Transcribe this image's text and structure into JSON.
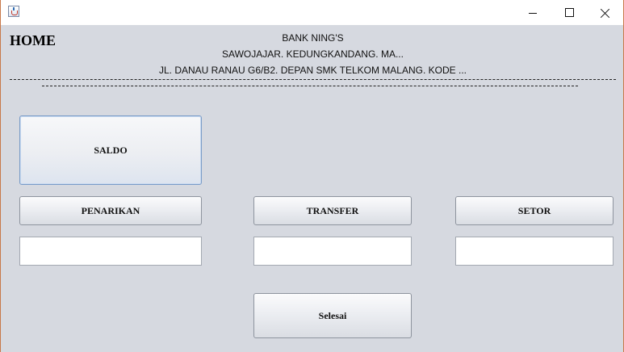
{
  "window": {
    "icon": "java-cup-icon",
    "controls": [
      "minimize-icon",
      "maximize-icon",
      "close-icon"
    ]
  },
  "header": {
    "title": "HOME",
    "line1": "BANK NING'S",
    "line2": "SAWOJAJAR. KEDUNGKANDANG. MA...",
    "line3": "JL. DANAU RANAU G6/B2. DEPAN SMK TELKOM MALANG. KODE ..."
  },
  "buttons": {
    "saldo": "SALDO",
    "penarikan": "PENARIKAN",
    "transfer": "TRANSFER",
    "setor": "SETOR",
    "selesai": "Selesai"
  },
  "fields": {
    "penarikan_value": "",
    "transfer_value": "",
    "setor_value": ""
  }
}
